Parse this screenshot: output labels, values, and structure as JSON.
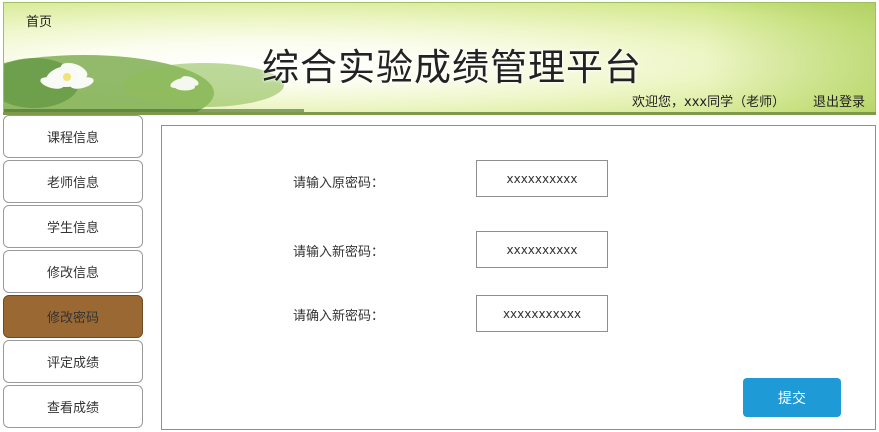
{
  "header": {
    "home_link": "首页",
    "site_title": "综合实验成绩管理平台",
    "welcome_text": "欢迎您，xxx同学（老师）",
    "logout_label": "退出登录"
  },
  "sidebar": {
    "items": [
      {
        "label": "课程信息"
      },
      {
        "label": "老师信息"
      },
      {
        "label": "学生信息"
      },
      {
        "label": "修改信息"
      },
      {
        "label": "修改密码"
      },
      {
        "label": "评定成绩"
      },
      {
        "label": "查看成绩"
      }
    ],
    "active_index": 4
  },
  "password_form": {
    "old_password": {
      "label": "请输入原密码：",
      "value": "xxxxxxxxxx"
    },
    "new_password": {
      "label": "请输入新密码：",
      "value": "xxxxxxxxxx"
    },
    "confirm_password": {
      "label": "请确入新密码：",
      "value": "xxxxxxxxxxx"
    },
    "submit_label": "提交"
  },
  "colors": {
    "active_nav": "#9a6833",
    "submit_button": "#1e9ad6",
    "banner_green": "#d6ea94"
  }
}
